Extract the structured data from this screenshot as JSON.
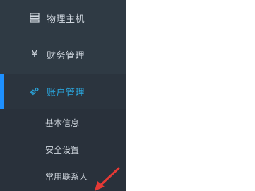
{
  "sidebar": {
    "items": [
      {
        "label": "物理主机",
        "icon": "server-icon"
      },
      {
        "label": "财务管理",
        "icon": "yen-icon"
      },
      {
        "label": "账户管理",
        "icon": "gears-icon",
        "active": true
      }
    ],
    "submenu": [
      {
        "label": "基本信息"
      },
      {
        "label": "安全设置"
      },
      {
        "label": "常用联系人"
      }
    ]
  },
  "colors": {
    "sidebar_bg": "#2f3a44",
    "submenu_bg": "#29313b",
    "active_text": "#2aa3d9",
    "active_bar": "#1e90ff",
    "arrow": "#e53935"
  }
}
